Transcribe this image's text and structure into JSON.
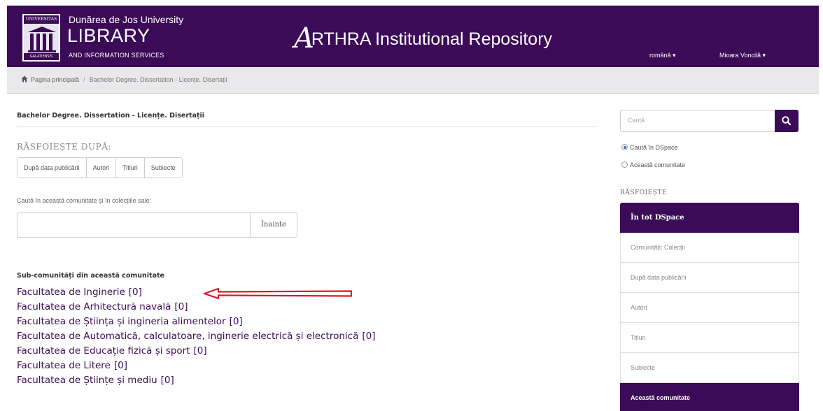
{
  "header": {
    "logo_top": "UNIVERSITAS",
    "logo_bottom": "GALATIENSIS",
    "university": "Dunărea de Jos University",
    "library": "LIBRARY",
    "library_sub": "AND INFORMATION SERVICES",
    "repo_initial": "A",
    "repo_title": "RTHRA Institutional Repository",
    "language": "română ▾",
    "user": "Mioara Voncilă ▾",
    "brand_color": "#3b0b57"
  },
  "breadcrumb": {
    "home": "Pagina principală",
    "separator": "/",
    "current": "Bachelor Degree. Dissertation - Licențe. Disertații"
  },
  "main": {
    "title": "Bachelor Degree. Dissertation - Licențe. Disertații",
    "browse_heading": "RĂSFOIEȘTE DUPĂ:",
    "browse_buttons": [
      "După data publicării",
      "Autori",
      "Titluri",
      "Subiecte"
    ],
    "search_label": "Caută în această comunitate și în colecțiile sale:",
    "search_value": "",
    "search_button": "Înainte",
    "subcommunities_heading": "Sub-comunități din această comunitate",
    "subcommunities": [
      {
        "name": "Facultatea de Inginerie",
        "count": "[0]"
      },
      {
        "name": "Facultatea de Arhitectură navală",
        "count": "[0]"
      },
      {
        "name": "Facultatea de Știința și ingineria alimentelor",
        "count": "[0]"
      },
      {
        "name": "Facultatea de Automatică, calculatoare, inginerie electrică și electronică",
        "count": "[0]"
      },
      {
        "name": "Facultatea de Educație fizică și sport",
        "count": "[0]"
      },
      {
        "name": "Facultatea de Litere",
        "count": "[0]"
      },
      {
        "name": "Facultatea de Științe și mediu",
        "count": "[0]"
      }
    ]
  },
  "sidebar": {
    "search_placeholder": "Caută",
    "scope_options": [
      "Caută în DSpace",
      "Această comunitate"
    ],
    "browse_heading": "RĂSFOIEȘTE",
    "items": [
      "În tot DSpace",
      "Comunități: Colecții",
      "După data publicării",
      "Autori",
      "Titluri",
      "Subiecte",
      "Această comunitate"
    ]
  },
  "annotation": {
    "arrow_color": "#e0191f"
  }
}
